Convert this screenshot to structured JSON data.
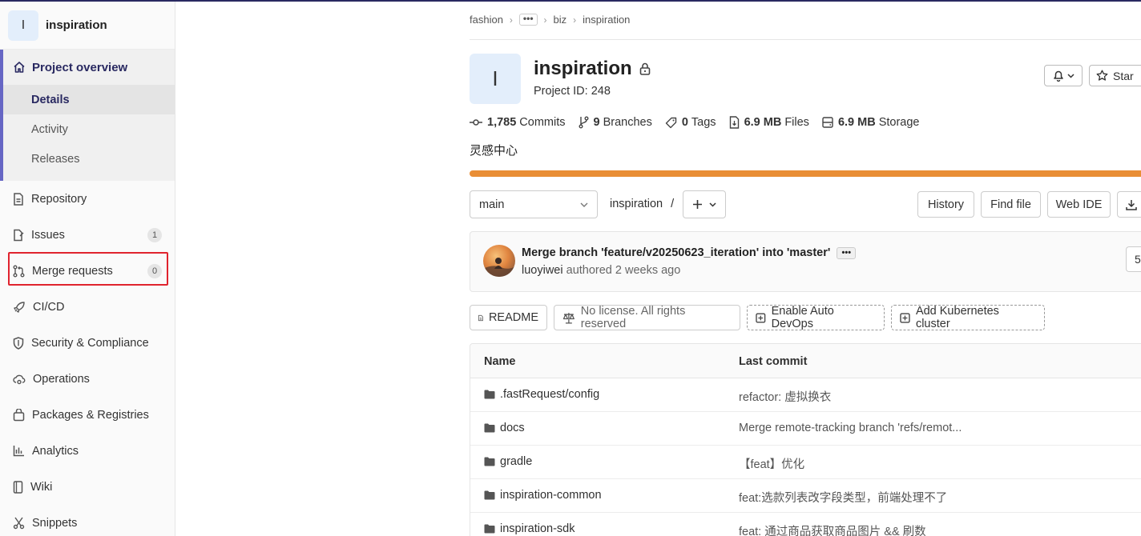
{
  "sidebar": {
    "project_initial": "I",
    "project_name": "inspiration",
    "overview_label": "Project overview",
    "overview_sub": [
      "Details",
      "Activity",
      "Releases"
    ],
    "items": [
      {
        "label": "Repository",
        "icon": "document-icon"
      },
      {
        "label": "Issues",
        "icon": "issues-icon",
        "badge": "1"
      },
      {
        "label": "Merge requests",
        "icon": "merge-request-icon",
        "badge": "0"
      },
      {
        "label": "CI/CD",
        "icon": "rocket-icon"
      },
      {
        "label": "Security & Compliance",
        "icon": "shield-icon"
      },
      {
        "label": "Operations",
        "icon": "cloud-gear-icon"
      },
      {
        "label": "Packages & Registries",
        "icon": "package-icon"
      },
      {
        "label": "Analytics",
        "icon": "chart-icon"
      },
      {
        "label": "Wiki",
        "icon": "book-icon"
      },
      {
        "label": "Snippets",
        "icon": "scissors-icon"
      }
    ]
  },
  "breadcrumb": [
    "fashion",
    "•••",
    "biz",
    "inspiration"
  ],
  "project": {
    "initial": "I",
    "title": "inspiration",
    "id_text": "Project ID: 248",
    "star_label": "Star",
    "description": "灵感中心"
  },
  "stats": [
    {
      "value": "1,785",
      "label": "Commits",
      "icon": "commit-icon"
    },
    {
      "value": "9",
      "label": "Branches",
      "icon": "branch-icon"
    },
    {
      "value": "0",
      "label": "Tags",
      "icon": "tag-icon"
    },
    {
      "value": "6.9 MB",
      "label": "Files",
      "icon": "file-icon"
    },
    {
      "value": "6.9 MB",
      "label": "Storage",
      "icon": "storage-icon"
    }
  ],
  "toolbar": {
    "branch": "main",
    "path": "inspiration",
    "path_sep": "/",
    "history": "History",
    "find_file": "Find file",
    "web_ide": "Web IDE"
  },
  "commit": {
    "title": "Merge branch 'feature/v20250623_iteration' into 'master'",
    "more": "•••",
    "author": "luoyiwei",
    "authored": "authored 2 weeks ago",
    "sha_partial": "5"
  },
  "chips": {
    "readme": "README",
    "license": "No license. All rights reserved",
    "auto_devops": "Enable Auto DevOps",
    "kubernetes": "Add Kubernetes cluster"
  },
  "table": {
    "headers": [
      "Name",
      "Last commit"
    ],
    "rows": [
      {
        "name": ".fastRequest/config",
        "msg": "refactor: 虚拟换衣"
      },
      {
        "name": "docs",
        "msg": "Merge remote-tracking branch 'refs/remot..."
      },
      {
        "name": "gradle",
        "msg": "【feat】优化"
      },
      {
        "name": "inspiration-common",
        "msg": "feat:选款列表改字段类型，前端处理不了"
      },
      {
        "name": "inspiration-sdk",
        "msg": "feat: 通过商品获取商品图片 && 刷数"
      }
    ]
  },
  "colors": {
    "accent": "#292961",
    "language_bar": "#e98e35",
    "highlight": "#e0232e"
  }
}
